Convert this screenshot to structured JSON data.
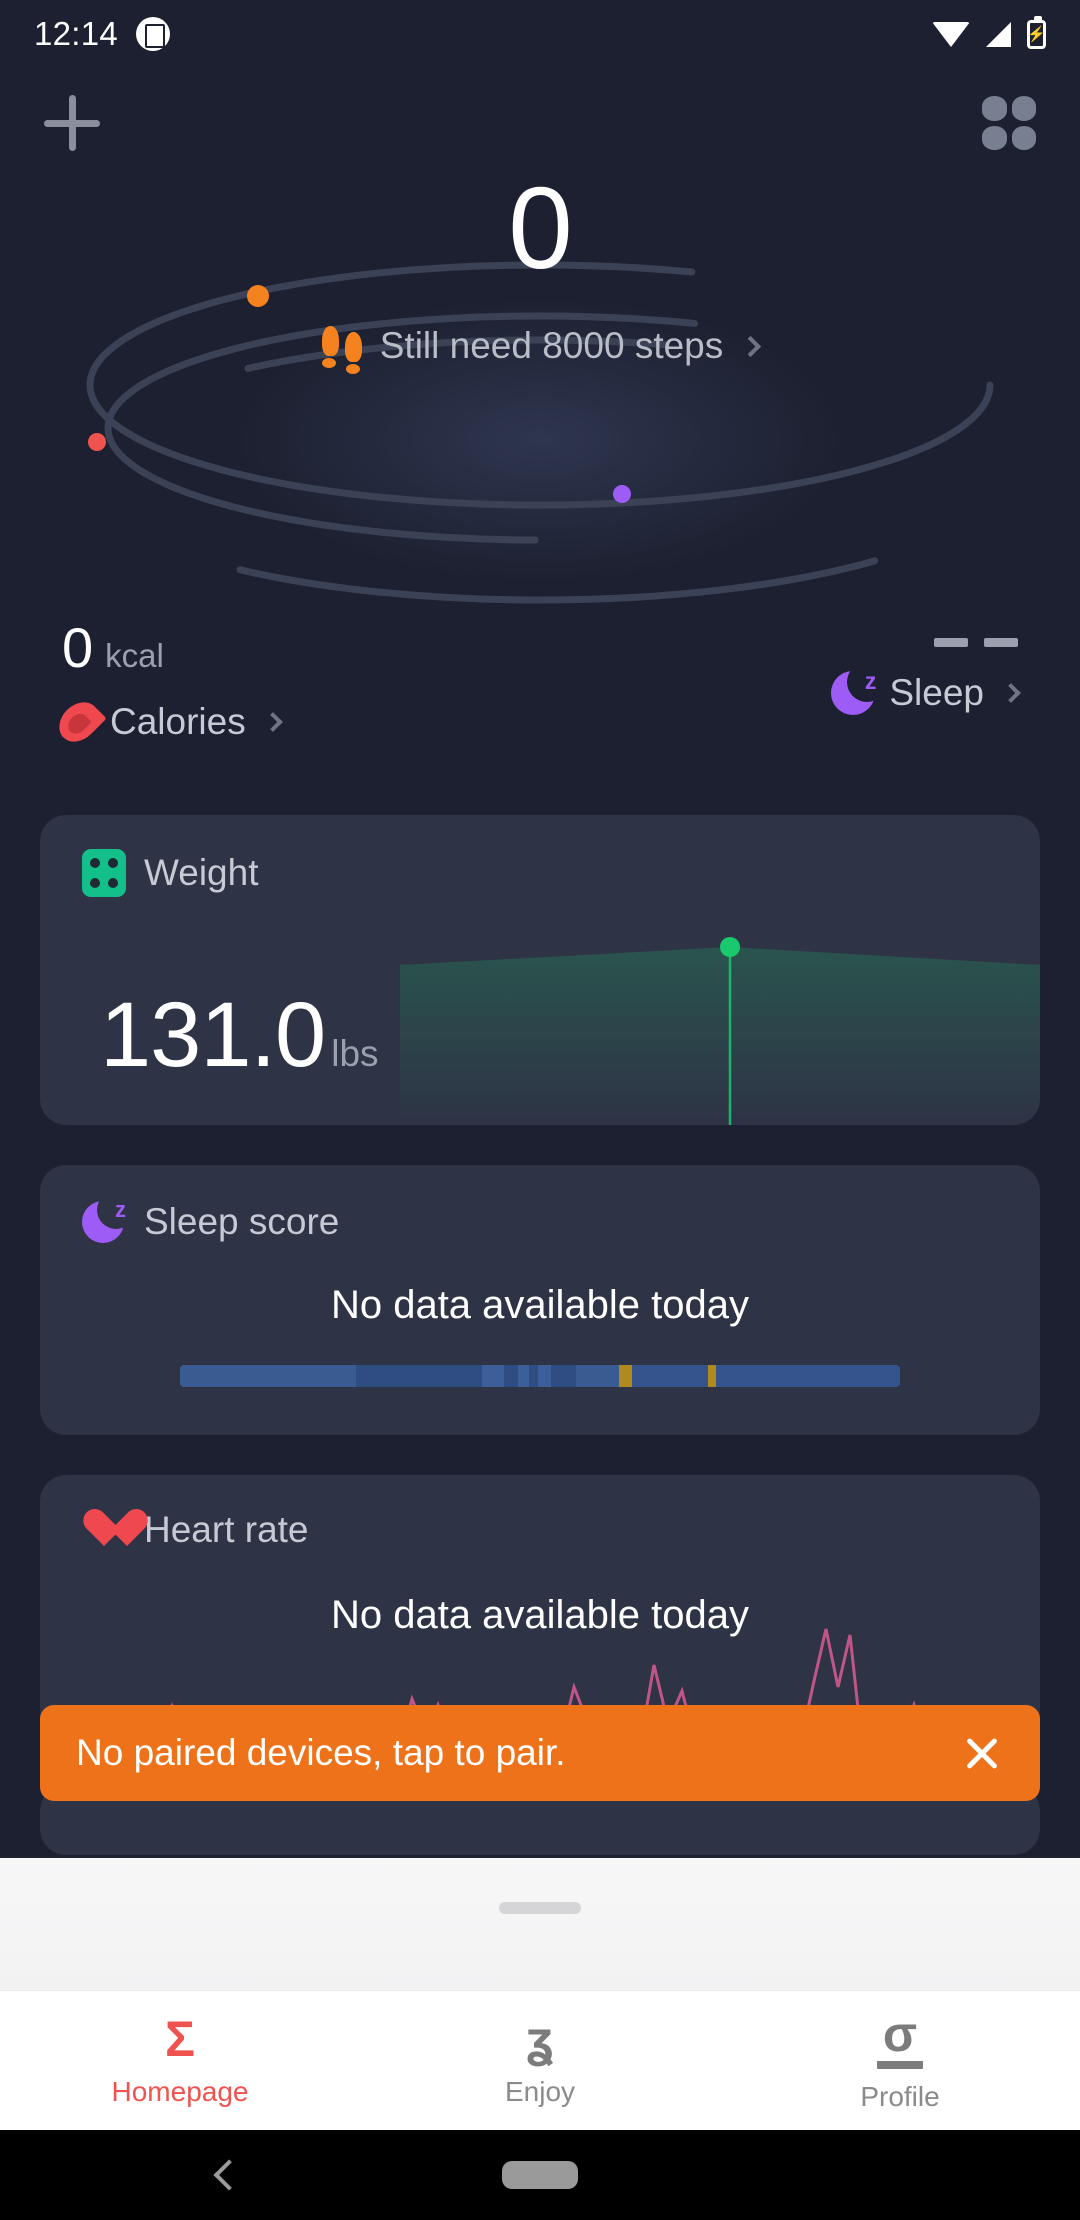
{
  "status_bar": {
    "time": "12:14",
    "notification_icon": "screenshot-icon",
    "wifi_icon": "wifi-icon",
    "signal_icon": "cellular-signal-icon",
    "battery_icon": "battery-charging-icon",
    "battery_glyph": "⚡"
  },
  "app_bar": {
    "add_icon": "plus-icon",
    "apps_icon": "grid-apps-icon"
  },
  "hero": {
    "steps_value": "0",
    "steps_hint": "Still need 8000 steps",
    "footprint_icon": "footprints-icon",
    "chevron_icon": "chevron-right-icon",
    "ring_dots": [
      {
        "name": "steps-ring-dot",
        "color": "#f4821f"
      },
      {
        "name": "calories-ring-dot",
        "color": "#ef5350"
      },
      {
        "name": "sleep-ring-dot",
        "color": "#9e5cf7"
      }
    ]
  },
  "metrics": {
    "calories": {
      "value": "0",
      "unit": "kcal",
      "label": "Calories",
      "icon": "flame-icon",
      "color": "#f0484f"
    },
    "sleep": {
      "value": "— —",
      "label": "Sleep",
      "icon": "moon-sleep-icon",
      "color": "#9e5cf7"
    }
  },
  "cards": {
    "weight": {
      "title": "Weight",
      "icon": "scale-icon",
      "icon_color": "#14c08a",
      "value": "131.0",
      "unit": "lbs",
      "point_color": "#19c96e"
    },
    "sleep_score": {
      "title": "Sleep score",
      "icon": "moon-sleep-icon",
      "icon_color": "#9e5cf7",
      "empty_text": "No data available today",
      "bar_segments": [
        {
          "color": "#3a5a92",
          "width": 24.5
        },
        {
          "color": "#2f4d83",
          "width": 17.5
        },
        {
          "color": "#3c5f9a",
          "width": 3.0
        },
        {
          "color": "#2f4d83",
          "width": 2.0
        },
        {
          "color": "#3c5f9a",
          "width": 1.5
        },
        {
          "color": "#2f4d83",
          "width": 1.2
        },
        {
          "color": "#3c5f9a",
          "width": 1.8
        },
        {
          "color": "#2f4d83",
          "width": 3.5
        },
        {
          "color": "#3a5a92",
          "width": 6.0
        },
        {
          "color": "#b08a1e",
          "width": 1.8
        },
        {
          "color": "#35538c",
          "width": 10.5
        },
        {
          "color": "#b08a1e",
          "width": 1.2
        },
        {
          "color": "#35538c",
          "width": 25.5
        }
      ]
    },
    "heart_rate": {
      "title": "Heart rate",
      "icon": "heart-icon",
      "icon_color": "#f0484f",
      "empty_text": "No data available today",
      "line_color": "#d05a8e"
    }
  },
  "toast": {
    "message": "No paired devices, tap to pair.",
    "close_icon": "close-icon",
    "background": "#ee7219"
  },
  "bottom_sheet": {
    "handle_icon": "drag-handle"
  },
  "bottom_nav": {
    "active_color": "#ef5350",
    "items": [
      {
        "label": "Homepage",
        "glyph": "Σ",
        "icon": "sigma-homepage-icon",
        "active": true
      },
      {
        "label": "Enjoy",
        "glyph": "ʓ",
        "icon": "enjoy-knot-icon",
        "active": false
      },
      {
        "label": "Profile",
        "glyph": "σ",
        "icon": "sigma-profile-icon",
        "active": false
      }
    ]
  },
  "android_nav": {
    "back_icon": "back-chevron-icon",
    "home_icon": "home-pill-icon"
  }
}
